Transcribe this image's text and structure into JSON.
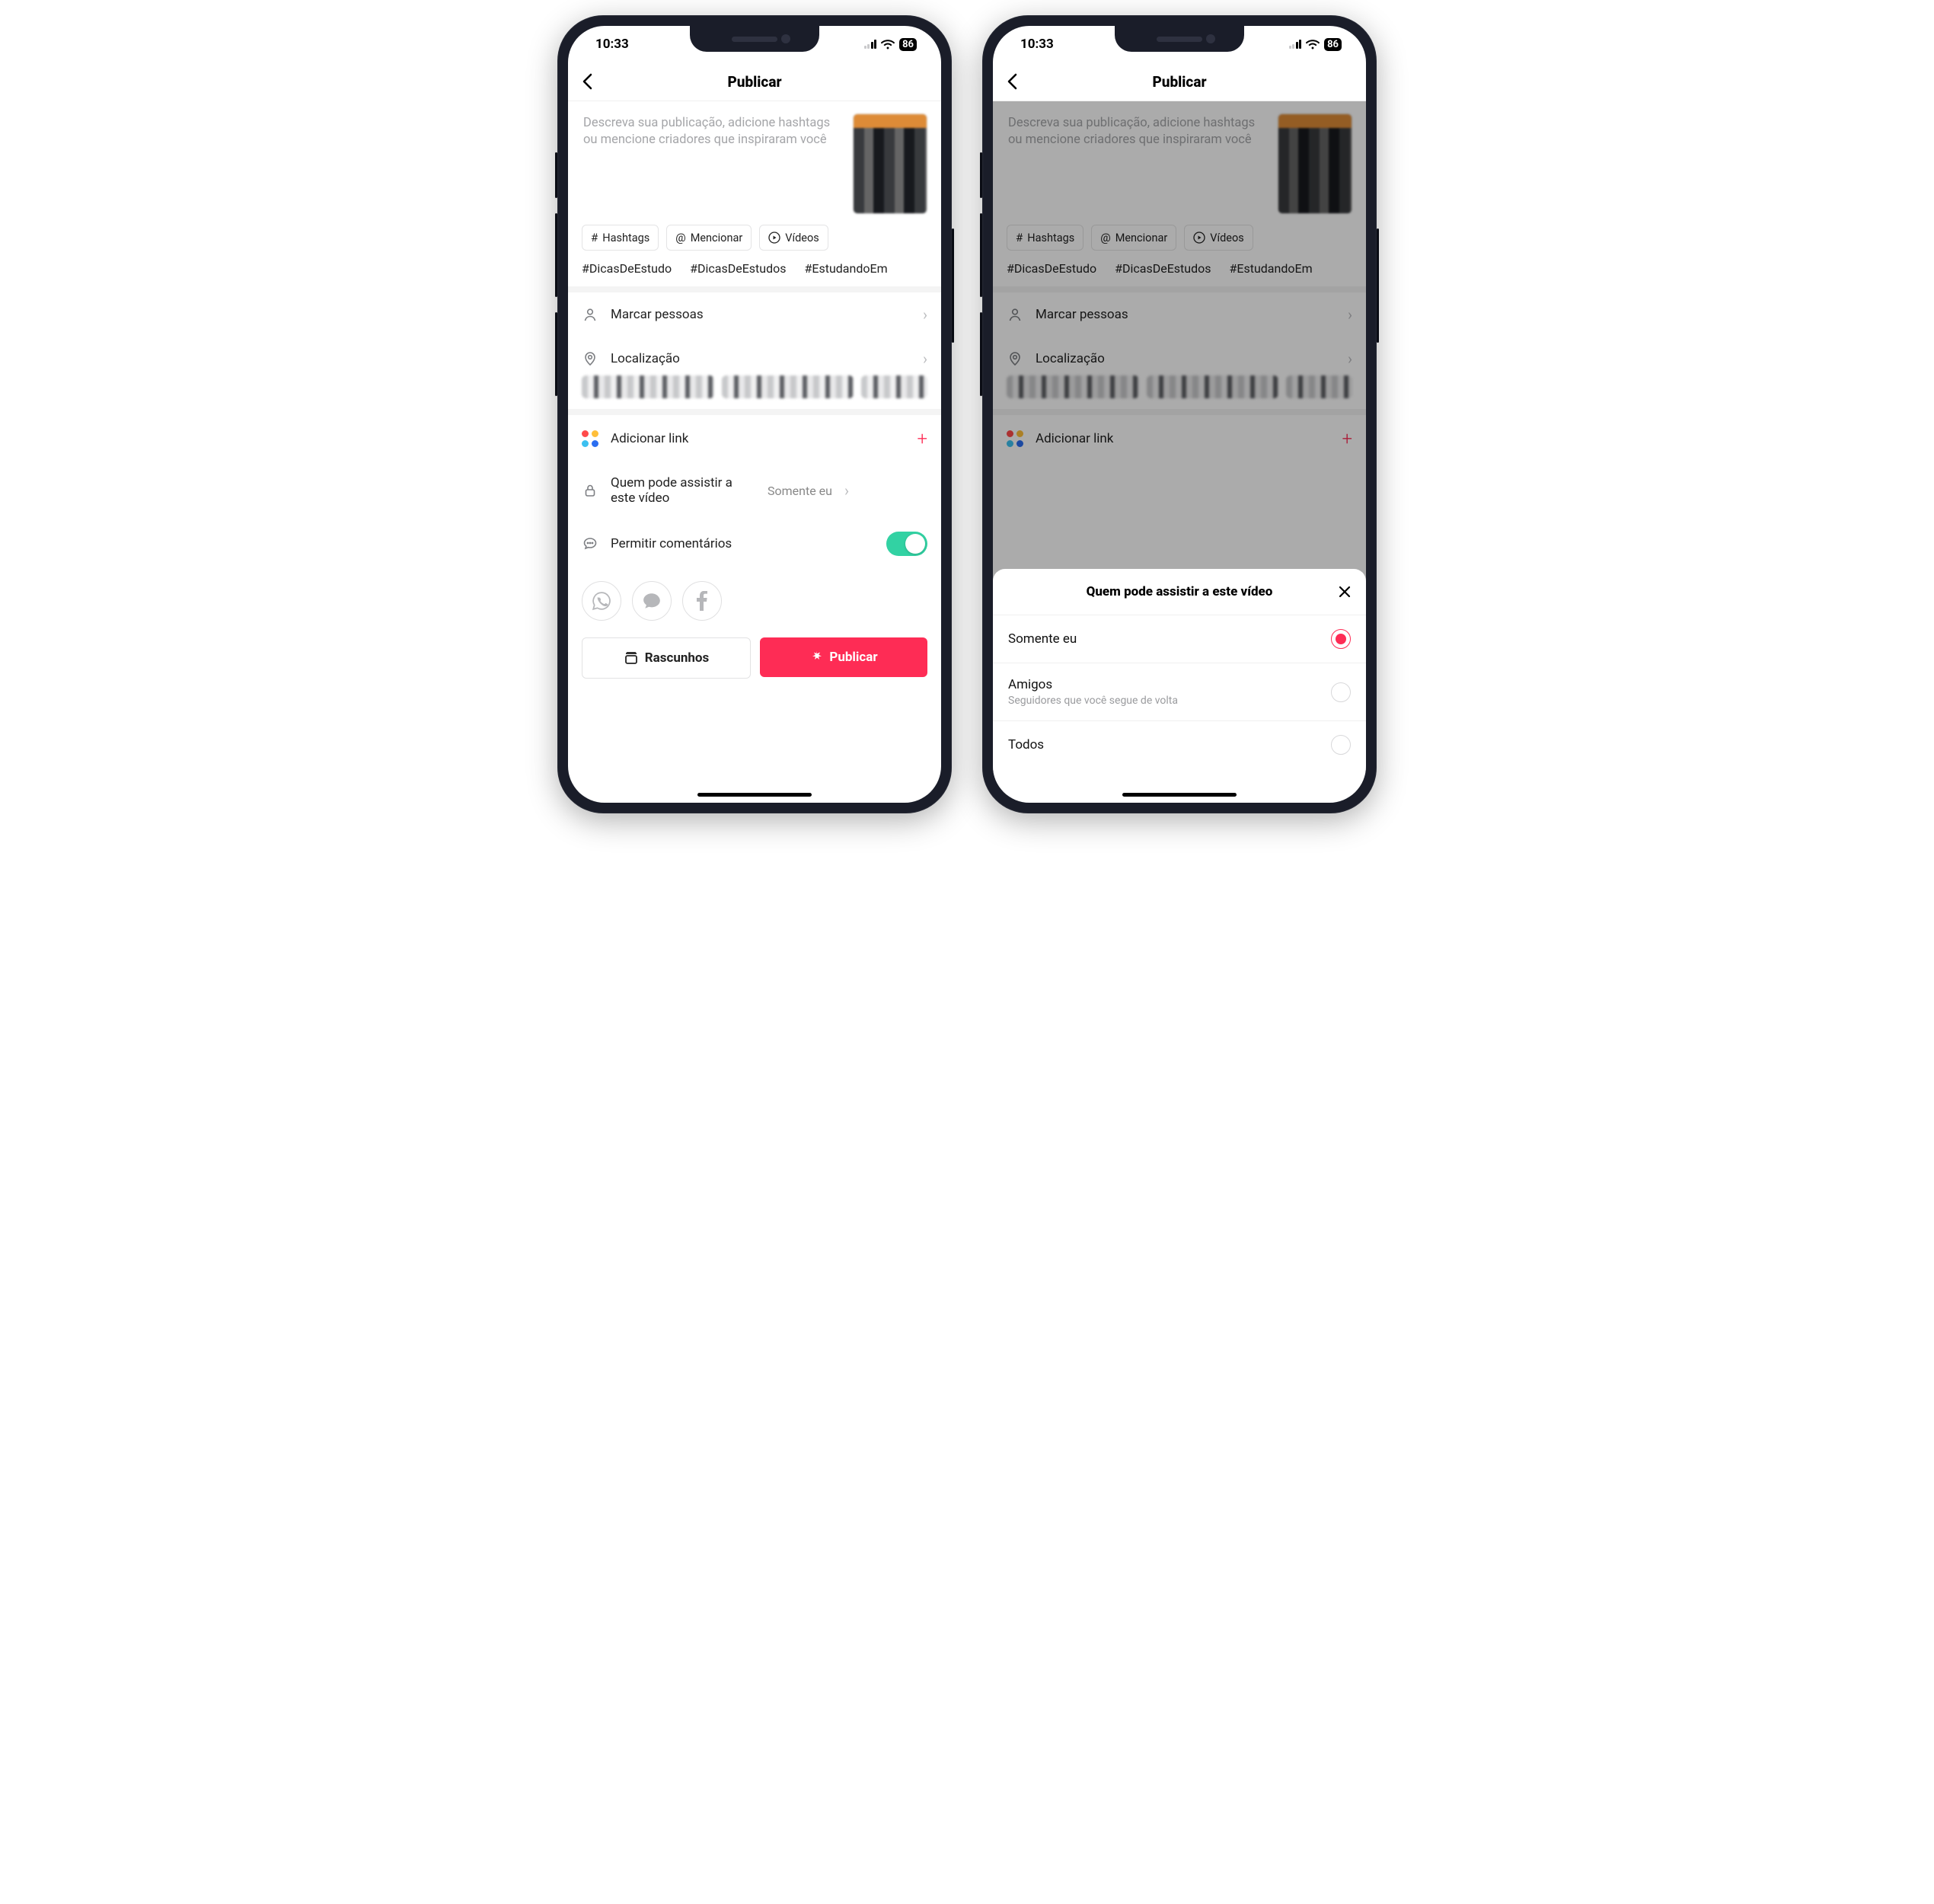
{
  "status": {
    "time": "10:33",
    "battery": "86"
  },
  "header": {
    "title": "Publicar"
  },
  "compose": {
    "placeholder": "Descreva sua publicação, adicione hashtags ou mencione criadores que inspiraram você"
  },
  "chips": {
    "hashtags": "Hashtags",
    "mention": "Mencionar",
    "videos": "Vídeos"
  },
  "suggested_hashtags": [
    "#DicasDeEstudo",
    "#DicasDeEstudos",
    "#EstudandoEm"
  ],
  "rows": {
    "tag_people": "Marcar pessoas",
    "location": "Localização",
    "add_link": "Adicionar link",
    "who_can_watch": "Quem pode assistir a este vídeo",
    "who_can_watch_value": "Somente eu",
    "allow_comments": "Permitir comentários"
  },
  "buttons": {
    "drafts": "Rascunhos",
    "publish": "Publicar"
  },
  "sheet": {
    "title": "Quem pode assistir a este vídeo",
    "options": [
      {
        "label": "Somente eu",
        "sub": "",
        "selected": true
      },
      {
        "label": "Amigos",
        "sub": "Seguidores que você segue de volta",
        "selected": false
      },
      {
        "label": "Todos",
        "sub": "",
        "selected": false
      }
    ]
  },
  "colors": {
    "primary": "#fe2c55",
    "toggle_on": "#32d2a3"
  }
}
